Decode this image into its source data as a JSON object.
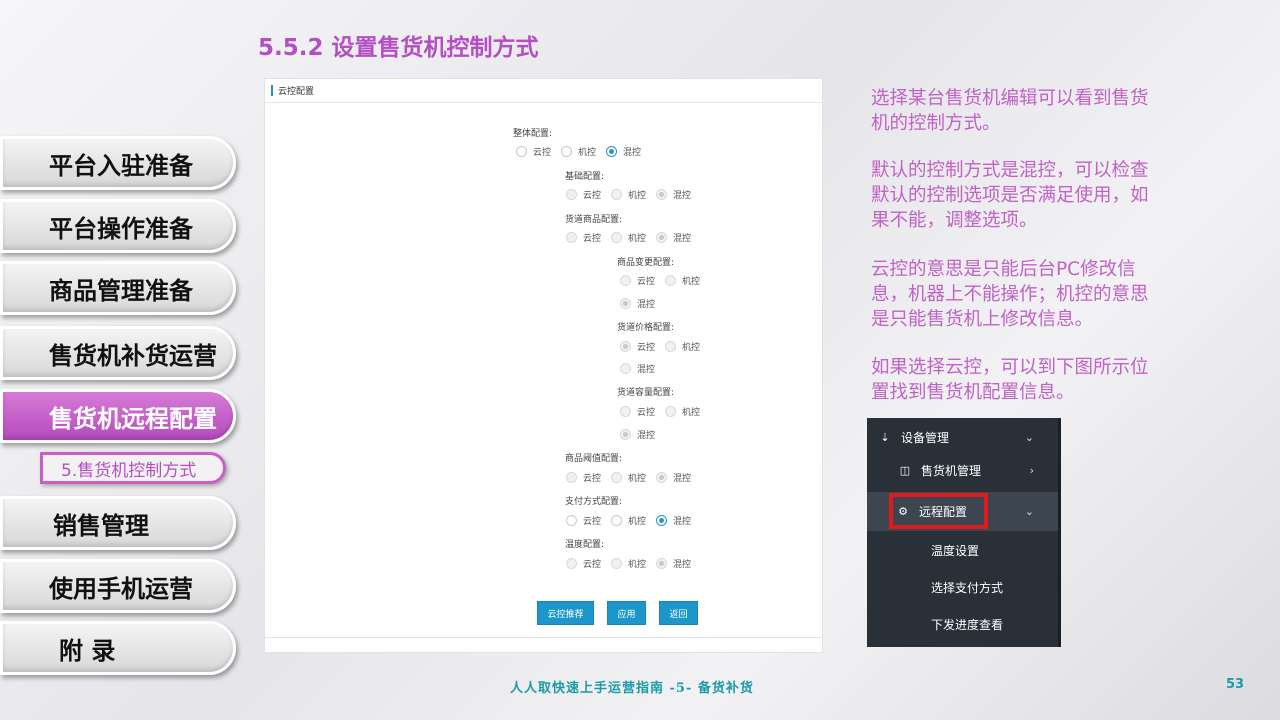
{
  "title": "5.5.2 设置售货机控制方式",
  "nav": {
    "items": [
      {
        "label": "平台入驻准备"
      },
      {
        "label": "平台操作准备"
      },
      {
        "label": "商品管理准备"
      },
      {
        "label": "售货机补货运营"
      },
      {
        "label": "售货机远程配置",
        "active": true
      },
      {
        "label": "销售管理"
      },
      {
        "label": "使用手机运营"
      },
      {
        "label": "附 录"
      }
    ],
    "sub_item": "5.售货机控制方式"
  },
  "panel": {
    "header": "云控配置",
    "options": [
      "云控",
      "机控",
      "混控"
    ],
    "groups": {
      "overall": {
        "label": "整体配置:",
        "selected": "混控"
      },
      "basic": {
        "label": "基础配置:",
        "selected": "混控"
      },
      "channel_goods": {
        "label": "货道商品配置:",
        "selected": "混控"
      },
      "goods_change": {
        "label": "商品变更配置:",
        "selected": "混控"
      },
      "channel_price": {
        "label": "货道价格配置:",
        "selected": "云控"
      },
      "channel_capacity": {
        "label": "货道容量配置:",
        "selected": "混控"
      },
      "goods_threshold": {
        "label": "商品阈值配置:",
        "selected": "混控"
      },
      "payment": {
        "label": "支付方式配置:",
        "selected": "混控"
      },
      "temperature": {
        "label": "温度配置:",
        "selected": "混控"
      }
    },
    "buttons": {
      "cloud_recommend": "云控推荐",
      "apply": "应用",
      "back": "返回"
    }
  },
  "description": {
    "p1": "选择某台售货机编辑可以看到售货机的控制方式。",
    "p2": "默认的控制方式是混控，可以检查默认的控制选项是否满足使用，如果不能，调整选项。",
    "p3": "云控的意思是只能后台PC修改信息，机器上不能操作；机控的意思是只能售货机上修改信息。",
    "p4": "如果选择云控，可以到下图所示位置找到售货机配置信息。"
  },
  "menu": {
    "device_mgmt": "设备管理",
    "vending_mgmt": "售货机管理",
    "remote_config": "远程配置",
    "temp_setting": "温度设置",
    "payment_select": "选择支付方式",
    "dispatch_progress": "下发进度查看"
  },
  "footer": {
    "text": "人人取快速上手运营指南 -5- 备货补货",
    "page": "53"
  },
  "colors": {
    "accent": "#b44fc3",
    "button_blue": "#1d97c9",
    "menu_bg": "#2a3038",
    "highlight_red": "#e01a1a",
    "footer": "#1a9ba5"
  }
}
